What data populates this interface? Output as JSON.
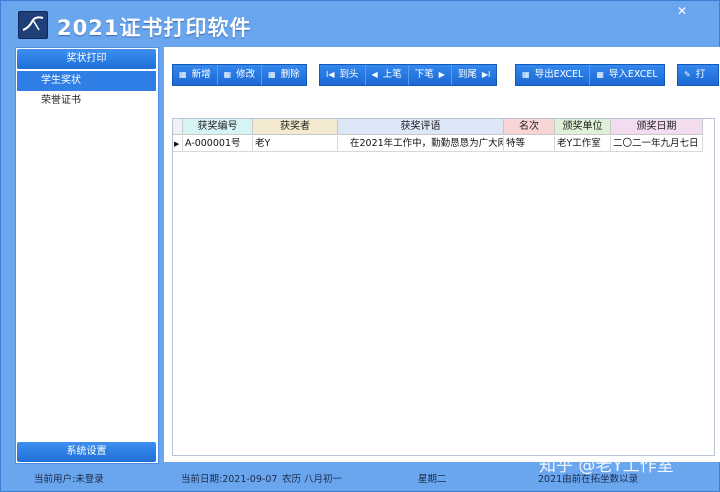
{
  "app": {
    "title": "2021证书打印软件"
  },
  "window_buttons": {
    "close": "✕"
  },
  "sidebar": {
    "header": "奖状打印",
    "items": [
      {
        "label": "学生奖状",
        "active": true
      },
      {
        "label": "荣誉证书",
        "active": false
      }
    ],
    "footer": "系统设置"
  },
  "toolbar": {
    "add": "新增",
    "edit": "修改",
    "delete": "删除",
    "first": "到头",
    "prev": "上笔",
    "next": "下笔",
    "last": "到尾",
    "export_excel": "导出EXCEL",
    "import_excel": "导入EXCEL",
    "print_partial": "打"
  },
  "icons": {
    "grid": "grid-icon",
    "first": "skip-first-icon",
    "prev": "triangle-left-icon",
    "next": "triangle-right-icon",
    "last": "skip-last-icon",
    "print": "pen-icon"
  },
  "table": {
    "columns": [
      "获奖编号",
      "获奖者",
      "获奖评语",
      "名次",
      "颁奖单位",
      "颁奖日期"
    ],
    "rows": [
      [
        "A-000001号",
        "老Y",
        "在2021年工作中，勤勤恳恳为广大网",
        "特等",
        "老Y工作室",
        "二〇二一年九月七日"
      ]
    ]
  },
  "colors": {
    "header_col1": "#d6f4f4",
    "header_col2": "#f4ead0",
    "header_col3": "#dde7f8",
    "header_col4": "#f8d6d6",
    "header_col5": "#def1d6",
    "header_col6": "#f4dcf0",
    "accent": "#2f7ee6"
  },
  "status": {
    "user": "当前用户:未登录",
    "date": "当前日期:2021-09-07",
    "lunar": "农历 八月初一",
    "weekday": "星期二",
    "record": "2021由前在拓坐数以录"
  },
  "watermark": "知乎 @老Y工作室"
}
